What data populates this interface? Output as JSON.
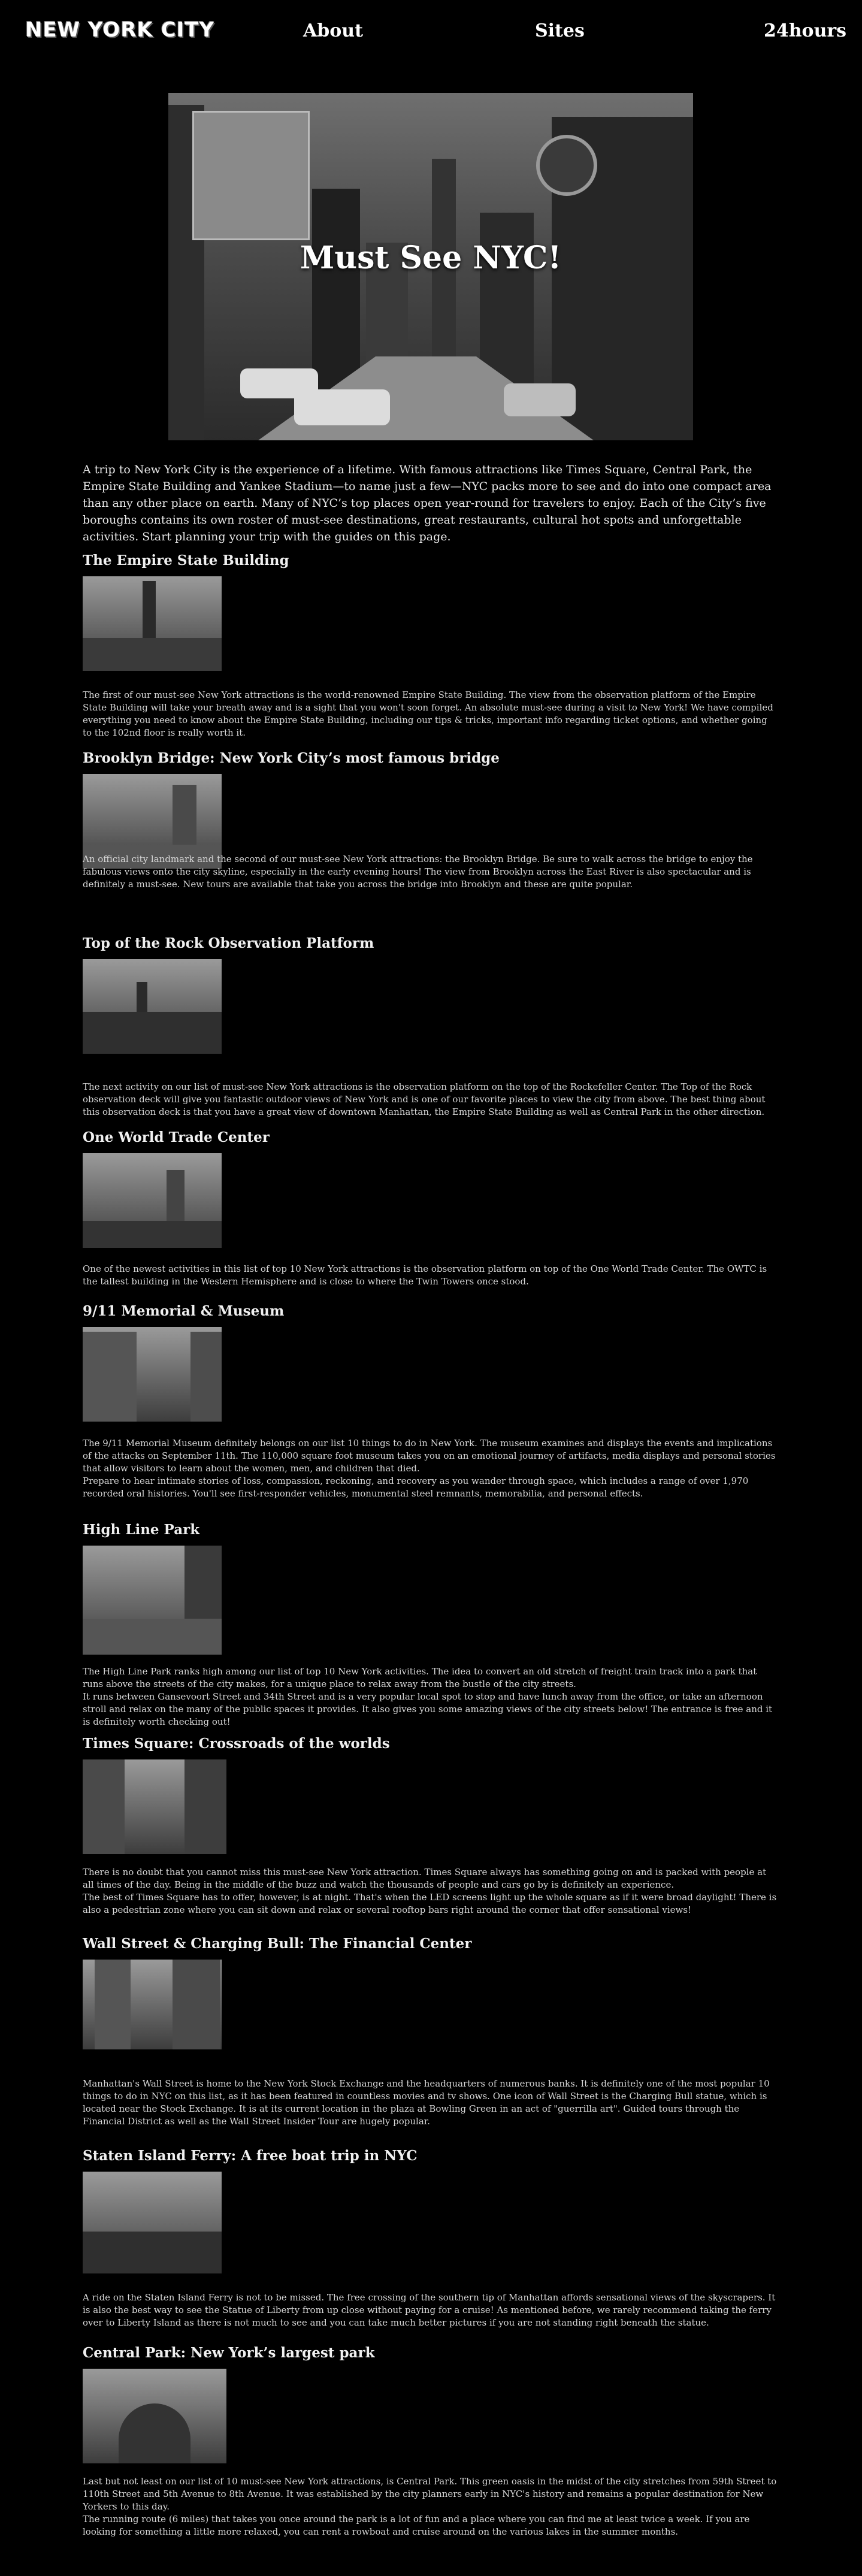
{
  "nav": {
    "logo": "NEW YORK CITY",
    "links": [
      "About",
      "Sites",
      "24hours"
    ]
  },
  "hero": {
    "title": "Must See NYC!"
  },
  "intro": "A trip to New York City is the experience of a lifetime. With famous attractions like Times Square, Central Park, the Empire State Building and Yankee Stadium—to name just a few—NYC packs more to see and do into one compact area than any other place on earth. Many of NYC’s top places open year-round for travelers to enjoy. Each of the City’s five boroughs contains its own roster of must-see destinations, great restaurants, cultural hot spots and unforgettable activities. Start planning your trip with the guides on this page.",
  "sections": [
    {
      "title": "The Empire State Building",
      "paragraphs": [
        "The first of our must-see New York attractions is the world-renowned Empire State Building. The view from the observation platform of the Empire State Building will take your breath away and is a sight that you won't soon forget. An absolute must-see during a visit to New York! We have compiled everything you need to know about the Empire State Building, including our tips & tricks, important info regarding ticket options, and whether going to the 102nd floor is really worth it."
      ]
    },
    {
      "title": "Brooklyn Bridge: New York City’s most famous bridge",
      "paragraphs": [
        "An official city landmark and the second of our must-see New York attractions: the Brooklyn Bridge. Be sure to walk across the bridge to enjoy the fabulous views onto the city skyline, especially in the early evening hours! The view from Brooklyn across the East River is also spectacular and is definitely a must-see. New tours are available that take you across the bridge into Brooklyn and these are quite popular."
      ]
    },
    {
      "title": "Top of the Rock Observation Platform",
      "paragraphs": [
        "The next activity on our list of must-see New York attractions is the observation platform on the top of the Rockefeller Center. The Top of the Rock observation deck will give you fantastic outdoor views of New York and is one of our favorite places to view the city from above. The best thing about this observation deck is that you have a great view of downtown Manhattan, the Empire State Building as well as Central Park in the other direction."
      ]
    },
    {
      "title": "One World Trade Center",
      "paragraphs": [
        "One of the newest activities in this list of top 10 New York attractions is the observation platform on top of the One World Trade Center.  The OWTC is the tallest building in the Western Hemisphere and is close to where the Twin Towers once stood."
      ]
    },
    {
      "title": "9/11 Memorial & Museum",
      "paragraphs": [
        "The 9/11 Memorial Museum definitely belongs on our list 10 things to do in New York. The museum examines and displays the events and implications of the attacks on September 11th. The 110,000 square foot museum takes you on an emotional journey of artifacts, media displays and personal stories that allow visitors to learn about the women, men, and children that died.",
        "Prepare to hear intimate stories of loss, compassion, reckoning, and recovery as you wander through space, which includes a range of over 1,970 recorded oral histories. You'll see first-responder vehicles, monumental steel remnants, memorabilia, and personal effects."
      ]
    },
    {
      "title": "High Line Park",
      "paragraphs": [
        "The High Line Park ranks high among our list of top 10 New York activities. The idea to convert an old stretch of freight train track into a park that runs above the streets of the city makes, for a unique place to relax away from the bustle of the city streets.",
        "It runs between Gansevoort Street and 34th Street and is a very popular local spot to stop and have lunch away from the office, or take an afternoon stroll and relax on the many of the public spaces it provides. It also gives you some amazing views of the city streets below! The entrance is free and it is definitely worth checking out!"
      ]
    },
    {
      "title": "Times Square: Crossroads of the worlds",
      "paragraphs": [
        "There is no doubt that you cannot miss this must-see New York attraction. Times Square always has something going on and is packed with people at all times of the day. Being in the middle of the buzz and watch the thousands of people and cars go by is definitely an experience.",
        "The best of Times Square has to offer, however, is at night. That's when the LED screens light up the whole square as if it were broad daylight! There is also a pedestrian zone where you can sit down and relax or several rooftop bars right around the corner that offer sensational views!"
      ]
    },
    {
      "title": "Wall Street & Charging Bull:  The Financial Center",
      "paragraphs": [
        "Manhattan's Wall Street is home to the New York Stock Exchange and the headquarters of numerous banks. It is definitely one of the most popular 10 things to do in NYC on this list, as it has been featured in countless movies and tv shows. One icon of Wall Street is the Charging Bull statue, which is located near the Stock Exchange. It is at its current location in the plaza at Bowling Green in an act of \"guerrilla art\". Guided tours through the Financial District as well as the Wall Street Insider Tour are hugely popular."
      ]
    },
    {
      "title": "Staten Island Ferry: A free boat trip in NYC",
      "paragraphs": [
        "A ride on the Staten Island Ferry is not to be missed. The free crossing of the southern tip of Manhattan affords sensational views of the skyscrapers. It is also the best way to see the Statue of Liberty from up close without paying for a cruise! As mentioned before, we rarely recommend taking the ferry over to Liberty Island as there is not much to see and you can take much better pictures if you are not standing right beneath the statue."
      ]
    },
    {
      "title": "Central Park: New York’s largest park",
      "paragraphs": [
        "Last but not least on our list of 10 must-see New York attractions, is Central Park. This green oasis in the midst of the city stretches from 59th Street to 110th Street and 5th Avenue to 8th Avenue. It was established by the city planners early in NYC's history and remains a popular destination for New Yorkers to this day.",
        "The running route (6 miles) that takes you once around the park is a lot of fun and a place where you can find me at least twice a week. If you are looking for something a little more relaxed, you can rent a rowboat and cruise around on the various lakes in the summer months."
      ]
    }
  ]
}
